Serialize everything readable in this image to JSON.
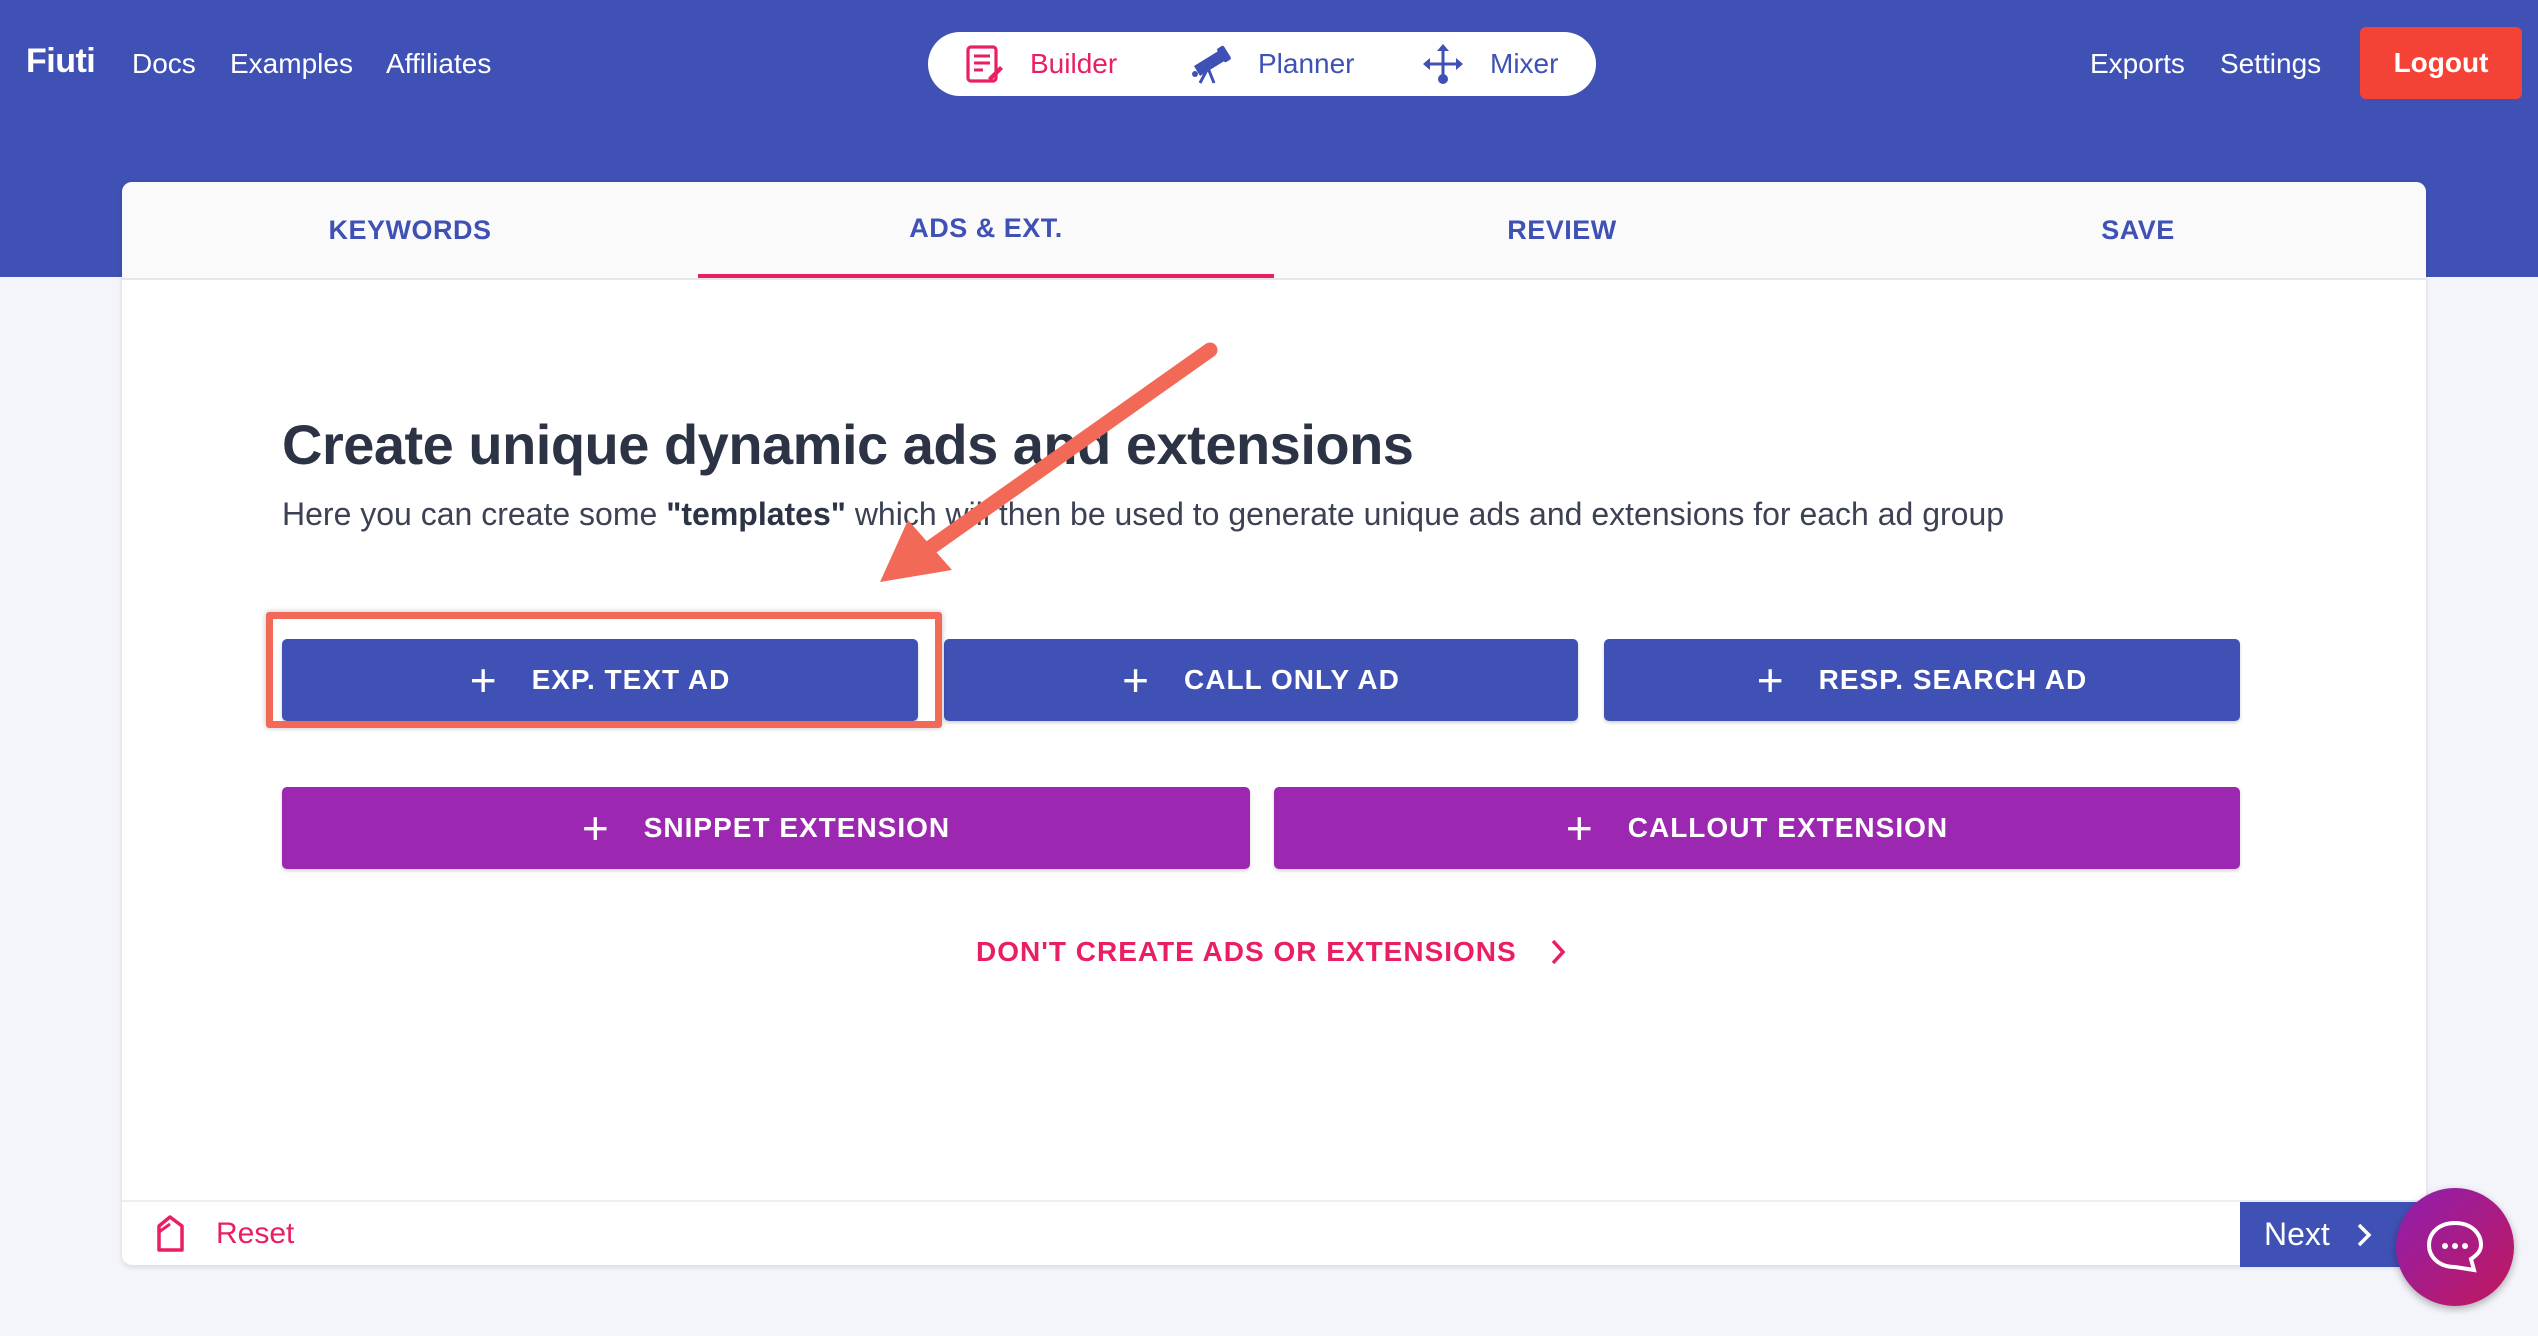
{
  "nav": {
    "brand": "Fiuti",
    "links": [
      "Docs",
      "Examples",
      "Affiliates"
    ],
    "modes": [
      {
        "label": "Builder",
        "icon": "builder-icon",
        "active": true
      },
      {
        "label": "Planner",
        "icon": "telescope-icon",
        "active": false
      },
      {
        "label": "Mixer",
        "icon": "mixer-arrows-icon",
        "active": false
      }
    ],
    "right_links": [
      "Exports",
      "Settings"
    ],
    "logout_label": "Logout"
  },
  "tabs": [
    {
      "label": "KEYWORDS",
      "active": false
    },
    {
      "label": "ADS & EXT.",
      "active": true
    },
    {
      "label": "REVIEW",
      "active": false
    },
    {
      "label": "SAVE",
      "active": false
    }
  ],
  "main": {
    "title": "Create unique dynamic ads and extensions",
    "subtitle_pre": "Here you can create some ",
    "subtitle_bold": "\"templates\"",
    "subtitle_post": " which will then be used to generate unique ads and extensions for each ad group",
    "ad_buttons": [
      {
        "label": "EXP. TEXT AD",
        "highlighted": true
      },
      {
        "label": "CALL ONLY AD",
        "highlighted": false
      },
      {
        "label": "RESP. SEARCH AD",
        "highlighted": false
      }
    ],
    "extension_buttons": [
      {
        "label": "SNIPPET EXTENSION"
      },
      {
        "label": "CALLOUT EXTENSION"
      }
    ],
    "skip_label": "DON'T CREATE ADS OR EXTENSIONS"
  },
  "footer": {
    "reset_label": "Reset",
    "next_label": "Next"
  },
  "colors": {
    "primary": "#3f51b5",
    "accent": "#e91e63",
    "extension": "#9c27b0",
    "logout": "#f44336",
    "annotation": "#f26a57"
  }
}
